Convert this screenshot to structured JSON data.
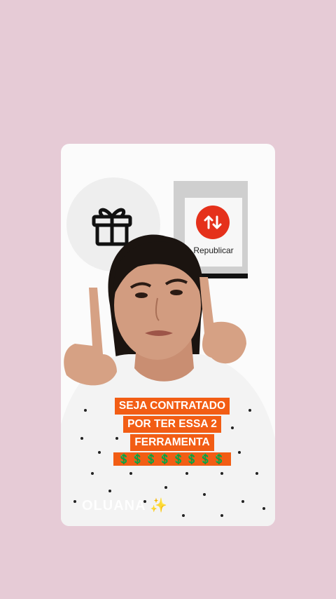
{
  "repost": {
    "label": "Republicar"
  },
  "caption": {
    "lines": [
      "SEJA CONTRATADO",
      "POR TER ESSA 2",
      "FERRAMENTA"
    ],
    "money": "💲💲💲💲💲💲💲💲"
  },
  "watermark": {
    "text": "OLUANA",
    "sparkle": "✨"
  },
  "colors": {
    "background": "#e6cbd6",
    "accent": "#f25d14",
    "repost_red": "#e5311b"
  }
}
